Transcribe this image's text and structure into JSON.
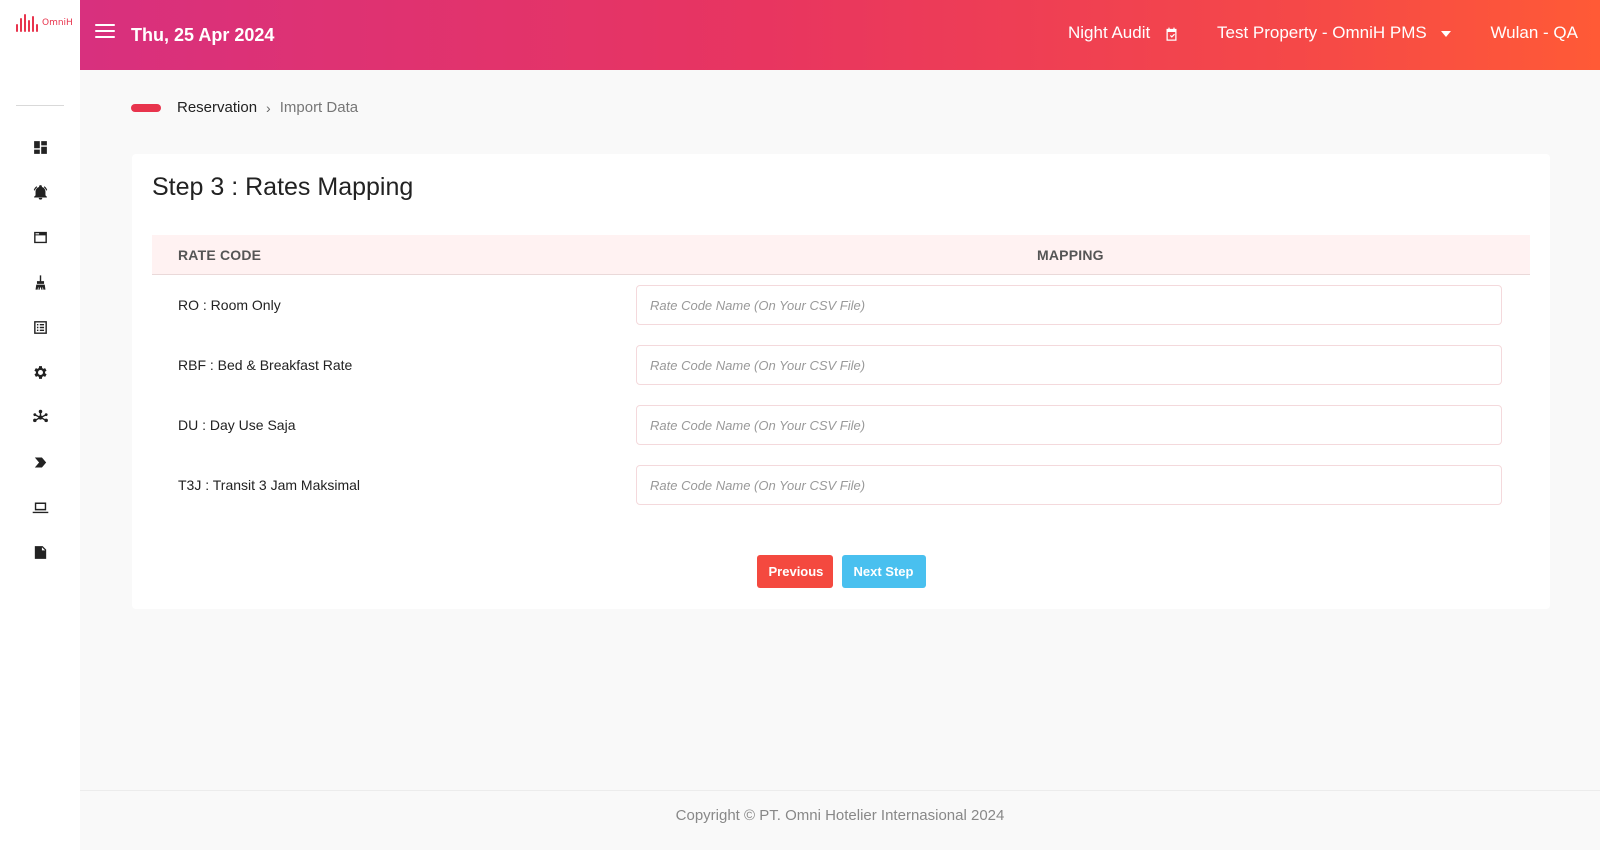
{
  "app": {
    "logo_text": "OmniH",
    "brand_color": "#e8344d"
  },
  "header": {
    "date": "Thu, 25 Apr 2024",
    "night_audit_label": "Night Audit",
    "property_label": "Test Property - OmniH PMS",
    "user_label": "Wulan - QA",
    "gradient": [
      "#d8307e",
      "#ff5a36"
    ]
  },
  "sidebar": {
    "items": [
      {
        "icon": "dashboard-icon"
      },
      {
        "icon": "bell-icon"
      },
      {
        "icon": "window-icon"
      },
      {
        "icon": "broom-icon"
      },
      {
        "icon": "list-icon"
      },
      {
        "icon": "gear-icon"
      },
      {
        "icon": "asterisk-icon"
      },
      {
        "icon": "chevron-tag-icon"
      },
      {
        "icon": "laptop-icon"
      },
      {
        "icon": "document-icon"
      }
    ]
  },
  "breadcrumb": {
    "parent": "Reservation",
    "separator": "›",
    "current": "Import Data"
  },
  "card": {
    "title": "Step 3 : Rates Mapping",
    "columns": {
      "rate_code": "RATE CODE",
      "mapping": "MAPPING"
    },
    "rows": [
      {
        "label": "RO : Room Only",
        "value": "",
        "placeholder": "Rate Code Name (On Your CSV File)"
      },
      {
        "label": "RBF : Bed & Breakfast Rate",
        "value": "",
        "placeholder": "Rate Code Name (On Your CSV File)"
      },
      {
        "label": "DU : Day Use Saja",
        "value": "",
        "placeholder": "Rate Code Name (On Your CSV File)"
      },
      {
        "label": "T3J : Transit 3 Jam Maksimal",
        "value": "",
        "placeholder": "Rate Code Name (On Your CSV File)"
      }
    ],
    "previous_label": "Previous",
    "next_label": "Next Step"
  },
  "footer": {
    "copyright": "Copyright © PT. Omni Hotelier Internasional 2024"
  },
  "colors": {
    "previous_button": "#f4493f",
    "next_button": "#49c0ef",
    "table_header_bg": "#fff2f2"
  }
}
